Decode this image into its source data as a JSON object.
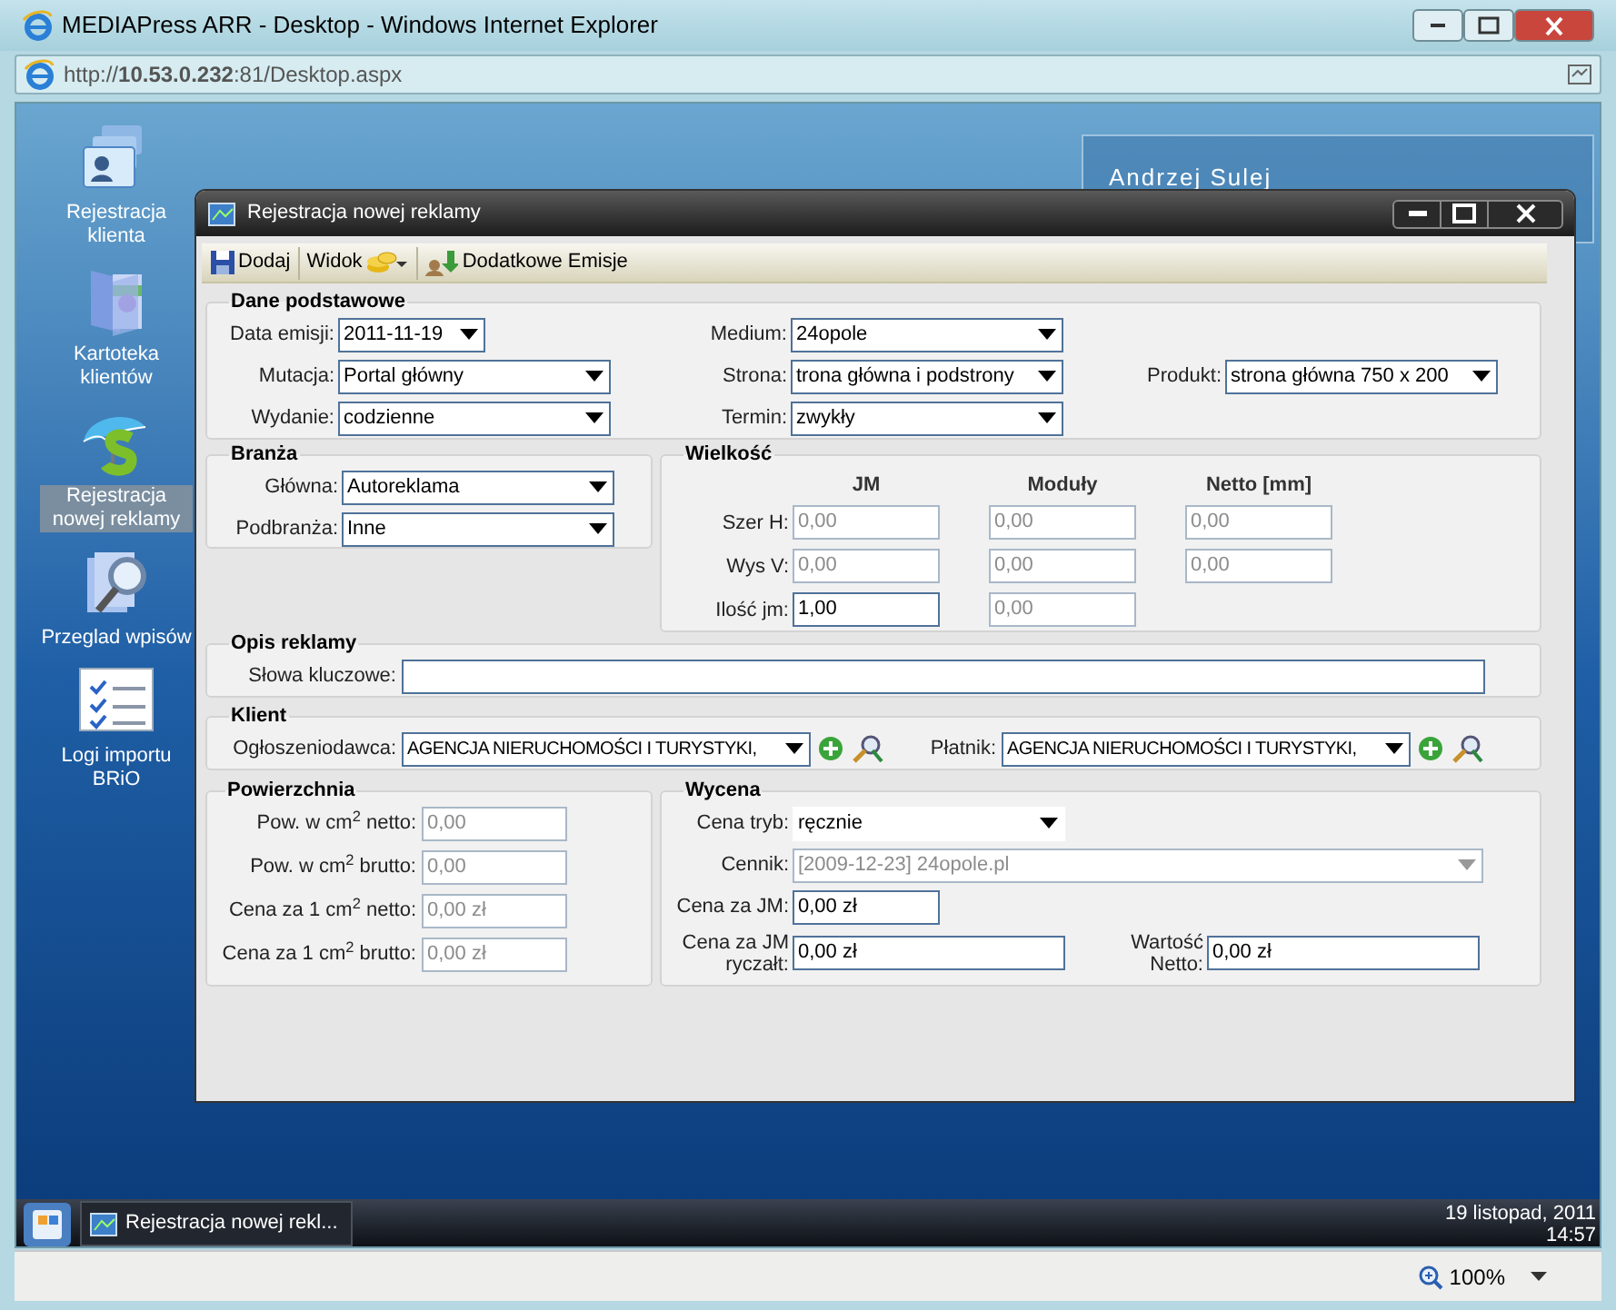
{
  "browser": {
    "title": "MEDIAPress ARR - Desktop - Windows Internet Explorer",
    "url": "http://**10.53.0.232**:81/Desktop.aspx",
    "zoom": "100%"
  },
  "desktop_icons": [
    {
      "label": "Rejestracja klienta",
      "kind": "cards",
      "selected": false
    },
    {
      "label": "Kartoteka klientów",
      "kind": "folder",
      "selected": false
    },
    {
      "label": "Rejestracja nowej reklamy",
      "kind": "umbrella",
      "selected": true
    },
    {
      "label": "Przeglad wpisów",
      "kind": "search",
      "selected": false
    },
    {
      "label": "Logi importu BRiO",
      "kind": "checklist",
      "selected": false
    }
  ],
  "user_name": "Andrzej Sulej",
  "dialog": {
    "title": "Rejestracja nowej reklamy",
    "toolbar": [
      {
        "label": "Dodaj",
        "kind": "save"
      },
      {
        "label": "Widok",
        "kind": "view"
      },
      {
        "label": "Dodatkowe Emisje",
        "kind": "emissions"
      }
    ],
    "basic": {
      "title": "Dane podstawowe",
      "columns": [
        [
          {
            "label": "Data emisji:",
            "value": "2011-11-19",
            "kind": "date",
            "disabled": false
          },
          {
            "label": "Mutacja:",
            "value": "Portal główny",
            "kind": "dropdown",
            "disabled": false
          },
          {
            "label": "Wydanie:",
            "value": "codzienne",
            "kind": "dropdown",
            "disabled": false
          }
        ],
        [
          {
            "label": "Medium:",
            "value": "24opole",
            "kind": "dropdown",
            "disabled": false
          },
          {
            "label": "Strona:",
            "value": "trona główna i podstrony",
            "kind": "dropdown",
            "disabled": false
          },
          {
            "label": "Termin:",
            "value": "zwykły",
            "kind": "dropdown",
            "disabled": false
          }
        ],
        [
          {
            "label": "Produkt:",
            "value": "strona główna 750 x 200",
            "kind": "dropdown",
            "disabled": false
          }
        ]
      ]
    },
    "branch": {
      "title": "Branża",
      "fields": [
        {
          "label": "Główna:",
          "value": "Autoreklama",
          "kind": "dropdown",
          "disabled": false
        },
        {
          "label": "Podbranża:",
          "value": "Inne",
          "kind": "dropdown",
          "disabled": false
        }
      ]
    },
    "size": {
      "title": "Wielkość",
      "columns": [
        "JM",
        "Moduły",
        "Netto [mm]"
      ],
      "rows": [
        {
          "label": "Szer H:",
          "cells": [
            {
              "value": "0,00",
              "disabled": true
            },
            {
              "value": "0,00",
              "disabled": true
            },
            {
              "value": "0,00",
              "disabled": true
            }
          ]
        },
        {
          "label": "Wys V:",
          "cells": [
            {
              "value": "0,00",
              "disabled": true
            },
            {
              "value": "0,00",
              "disabled": true
            },
            {
              "value": "0,00",
              "disabled": true
            }
          ]
        },
        {
          "label": "Ilość jm:",
          "cells": [
            {
              "value": "1,00",
              "disabled": false
            },
            {
              "value": "0,00",
              "disabled": true
            }
          ]
        }
      ]
    },
    "description": {
      "title": "Opis reklamy",
      "label": "Słowa kluczowe:"
    },
    "client": {
      "title": "Klient",
      "fields": [
        {
          "label": "Ogłoszeniodawca:",
          "value": "AGENCJA NIERUCHOMOŚCI I TURYSTYKI,"
        },
        {
          "label": "Płatnik:",
          "value": "AGENCJA NIERUCHOMOŚCI I TURYSTYKI,"
        }
      ]
    },
    "area": {
      "title": "Powierzchnia",
      "fields": [
        {
          "label": "Pow. w cm$^{2}$ netto:",
          "value": "0,00",
          "disabled": true
        },
        {
          "label": "Pow. w cm$^{2}$ brutto:",
          "value": "0,00",
          "disabled": true
        },
        {
          "label": "Cena za 1 cm$^{2}$ netto:",
          "value": "0,00 zł",
          "disabled": true
        },
        {
          "label": "Cena za 1 cm$^{2}$ brutto:",
          "value": "0,00 zł",
          "disabled": true
        }
      ]
    },
    "pricing": {
      "title": "Wycena",
      "fields": [
        {
          "label": "Cena tryb:",
          "value": "ręcznie",
          "kind": "plain-dropdown",
          "disabled": false
        },
        {
          "label": "Cennik:",
          "value": "[2009-12-23] 24opole.pl",
          "kind": "wide-dropdown",
          "disabled": true
        },
        {
          "label": "Cena za JM:",
          "value": "0,00 zł",
          "kind": "short-text",
          "disabled": false
        },
        {
          "label": "Cena za JM ryczałt:",
          "value": "0,00 zł",
          "kind": "text",
          "disabled": false
        },
        {
          "label": "Wartość Netto:",
          "value": "0,00 zł",
          "kind": "text",
          "disabled": false
        }
      ]
    }
  },
  "taskbar": {
    "items": [
      {
        "label": "Rejestracja nowej rekl..."
      }
    ],
    "date": "19 listopad, 2011",
    "time": "14:57"
  }
}
